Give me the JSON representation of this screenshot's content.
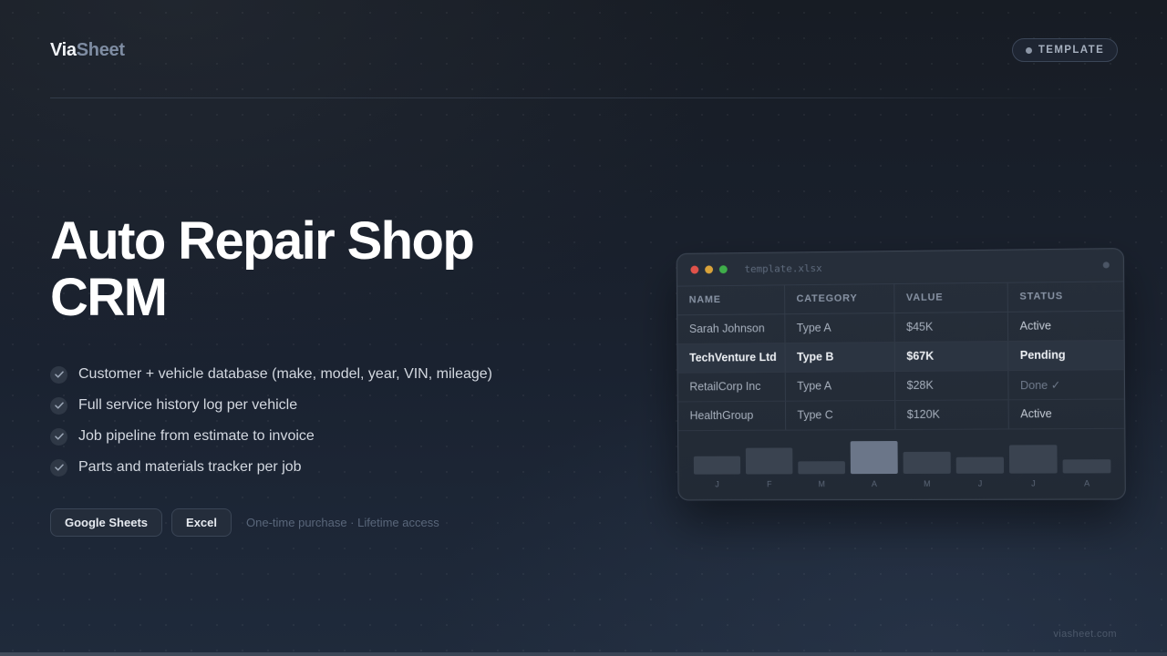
{
  "brand": {
    "part1": "Via",
    "part2": "Sheet"
  },
  "badge": {
    "label": "TEMPLATE"
  },
  "hero": {
    "title": "Auto Repair Shop CRM"
  },
  "features": [
    "Customer + vehicle database (make, model, year, VIN, mileage)",
    "Full service history log per vehicle",
    "Job pipeline from estimate to invoice",
    "Parts and materials tracker per job"
  ],
  "buttons": {
    "google": "Google Sheets",
    "excel": "Excel"
  },
  "purchase_note": "One-time purchase · Lifetime access",
  "preview": {
    "filename": "template.xlsx",
    "columns": [
      "NAME",
      "CATEGORY",
      "VALUE",
      "STATUS"
    ],
    "rows": [
      [
        "Sarah Johnson",
        "Type A",
        "$45K",
        "Active"
      ],
      [
        "TechVenture Ltd",
        "Type B",
        "$67K",
        "Pending"
      ],
      [
        "RetailCorp Inc",
        "Type A",
        "$28K",
        "Done ✓"
      ],
      [
        "HealthGroup",
        "Type C",
        "$120K",
        "Active"
      ]
    ]
  },
  "chart_data": {
    "type": "bar",
    "categories": [
      "J",
      "F",
      "M",
      "A",
      "M",
      "J",
      "J",
      "A"
    ],
    "values": [
      20,
      29,
      14,
      36,
      24,
      18,
      31,
      15
    ],
    "highlight_index": 3,
    "title": "",
    "xlabel": "",
    "ylabel": "",
    "ylim": [
      0,
      40
    ],
    "colors": {
      "bar": "#3a4350",
      "highlight": "#6b7689"
    }
  },
  "footer": {
    "site": "viasheet.com"
  }
}
